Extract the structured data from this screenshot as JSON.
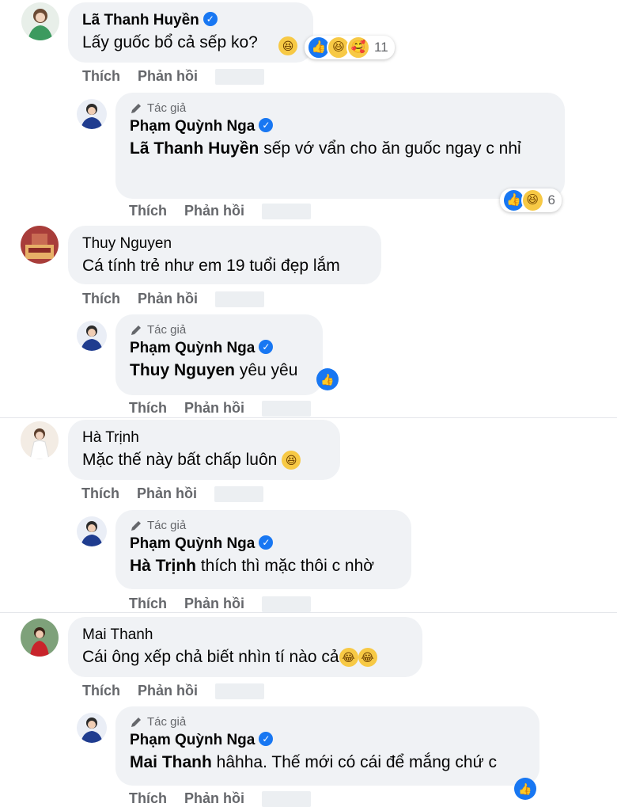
{
  "actions": {
    "like": "Thích",
    "reply": "Phản hồi"
  },
  "author_tag": "Tác giả",
  "comments": [
    {
      "name": "Lã Thanh Huyền",
      "verified": true,
      "text": "Lấy guốc bổ cả sếp ko?",
      "reaction_count": "11",
      "replies": [
        {
          "name": "Phạm Quỳnh Nga",
          "mention": "Lã Thanh Huyền",
          "text": " sếp vớ vẩn cho ăn guốc ngay c nhỉ",
          "reaction_count": "6"
        }
      ]
    },
    {
      "name": "Thuy Nguyen",
      "text": "Cá tính trẻ như em 19 tuổi đẹp lắm",
      "replies": [
        {
          "name": "Phạm Quỳnh Nga",
          "mention": "Thuy Nguyen",
          "text": " yêu yêu"
        }
      ]
    },
    {
      "name": "Hà Trịnh",
      "text": "Mặc thế này bất chấp luôn",
      "replies": [
        {
          "name": "Phạm Quỳnh Nga",
          "mention": "Hà Trịnh",
          "text": " thích thì mặc thôi c nhờ"
        }
      ]
    },
    {
      "name": "Mai Thanh",
      "text": "Cái ông xếp chả biết nhìn tí nào cả",
      "replies": [
        {
          "name": "Phạm Quỳnh Nga",
          "mention": "Mai Thanh",
          "text": " hâhha. Thế mới có cái để mắng chứ c"
        }
      ]
    }
  ],
  "colors": {
    "like_blue": "#1877f2",
    "bubble_bg": "#f0f2f5",
    "meta_gray": "#65676b"
  }
}
